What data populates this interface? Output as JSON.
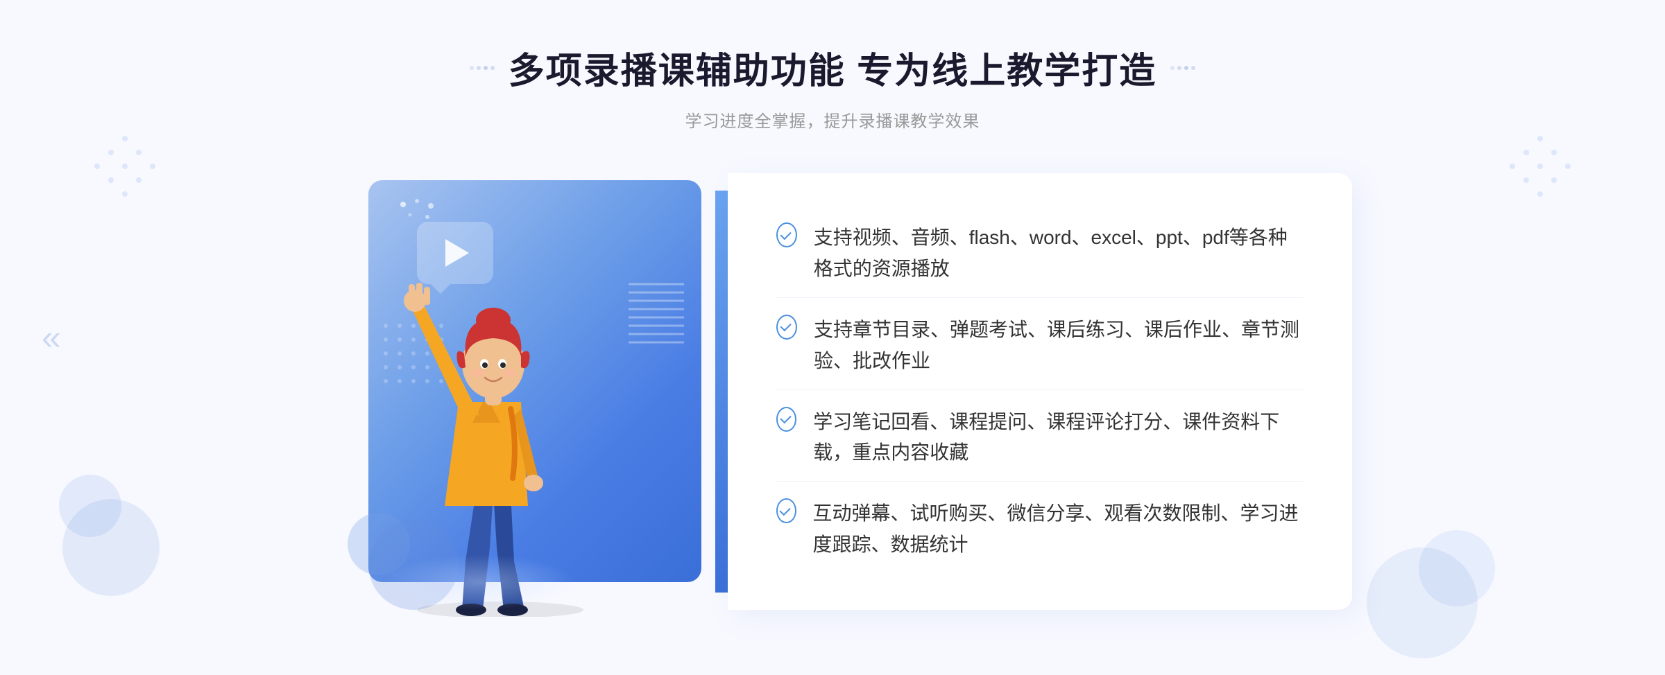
{
  "page": {
    "background_color": "#f4f7ff"
  },
  "header": {
    "title": "多项录播课辅助功能 专为线上教学打造",
    "subtitle": "学习进度全掌握，提升录播课教学效果",
    "title_decorator_left": "···· ",
    "title_decorator_right": " ····"
  },
  "features": [
    {
      "id": 1,
      "text": "支持视频、音频、flash、word、excel、ppt、pdf等各种格式的资源播放"
    },
    {
      "id": 2,
      "text": "支持章节目录、弹题考试、课后练习、课后作业、章节测验、批改作业"
    },
    {
      "id": 3,
      "text": "学习笔记回看、课程提问、课程评论打分、课件资料下载，重点内容收藏"
    },
    {
      "id": 4,
      "text": "互动弹幕、试听购买、微信分享、观看次数限制、学习进度跟踪、数据统计"
    }
  ],
  "colors": {
    "primary_blue": "#4a7de4",
    "light_blue": "#a8c4f0",
    "check_blue": "#4a90e2",
    "text_dark": "#333333",
    "text_gray": "#999999",
    "bg_light": "#f4f7ff"
  },
  "illustration": {
    "play_icon": "▶",
    "chevron_left": "«"
  }
}
